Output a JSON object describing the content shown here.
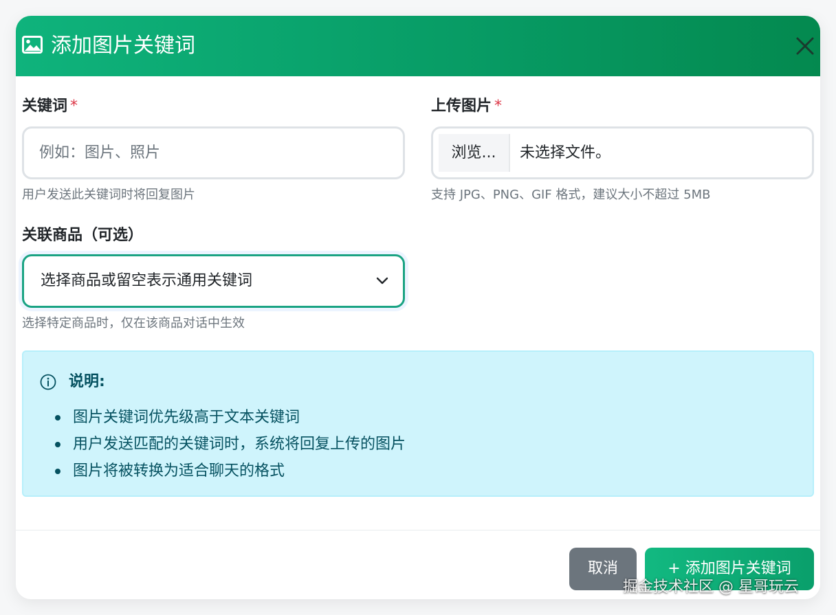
{
  "modal": {
    "title": "添加图片关键词",
    "close_icon": "close-icon",
    "title_icon": "image-icon"
  },
  "keyword": {
    "label": "关键词",
    "required_mark": "*",
    "placeholder": "例如：图片、照片",
    "value": "",
    "help": "用户发送此关键词时将回复图片"
  },
  "upload": {
    "label": "上传图片",
    "required_mark": "*",
    "browse_label": "浏览...",
    "file_status": "未选择文件。",
    "help": "支持 JPG、PNG、GIF 格式，建议大小不超过 5MB"
  },
  "product": {
    "label": "关联商品（可选）",
    "selected": "选择商品或留空表示通用关键词",
    "help": "选择特定商品时，仅在该商品对话中生效"
  },
  "info": {
    "title": "说明:",
    "icon": "info-circle-icon",
    "items": [
      "图片关键词优先级高于文本关键词",
      "用户发送匹配的关键词时，系统将回复上传的图片",
      "图片将被转换为适合聊天的格式"
    ]
  },
  "footer": {
    "cancel_label": "取消",
    "submit_label": "+ 添加图片关键词"
  },
  "watermark": "掘金技术社区 @ 星哥玩云",
  "colors": {
    "header_start": "#0fb37c",
    "header_end": "#04894f",
    "required": "#dc3545",
    "info_bg": "#cff4fc",
    "info_text": "#055160",
    "cancel_bg": "#6c757d",
    "submit_bg": "#12b981"
  }
}
